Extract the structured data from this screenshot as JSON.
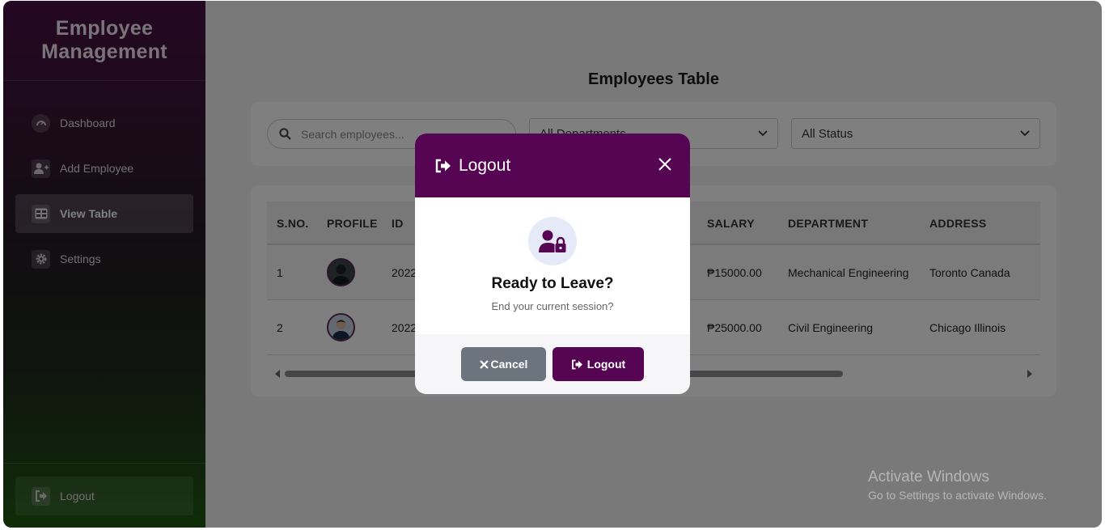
{
  "sidebar": {
    "brand": "Employee Management",
    "items": [
      {
        "label": "Dashboard",
        "icon": "dashboard-icon"
      },
      {
        "label": "Add Employee",
        "icon": "user-plus-icon"
      },
      {
        "label": "View Table",
        "icon": "table-icon",
        "active": true
      },
      {
        "label": "Settings",
        "icon": "gear-icon"
      }
    ],
    "logout_label": "Logout"
  },
  "main": {
    "title": "Employees Table",
    "search_placeholder": "Search employees...",
    "department_filter": "All Departments",
    "status_filter": "All Status",
    "table": {
      "columns": [
        "S.NO.",
        "PROFILE",
        "ID",
        "SALARY",
        "DEPARTMENT",
        "ADDRESS"
      ],
      "rows": [
        {
          "sno": "1",
          "id": "2022",
          "salary": "₱15000.00",
          "department": "Mechanical Engineering",
          "address": "Toronto Canada"
        },
        {
          "sno": "2",
          "id": "2022",
          "salary": "₱25000.00",
          "department": "Civil Engineering",
          "address": "Chicago Illinois"
        }
      ]
    }
  },
  "modal": {
    "title": "Logout",
    "heading": "Ready to Leave?",
    "message": "End your current session?",
    "cancel_label": "Cancel",
    "confirm_label": "Logout"
  },
  "watermark": {
    "line1": "Activate Windows",
    "line2": "Go to Settings to activate Windows."
  },
  "colors": {
    "accent": "#560552",
    "cancel": "#6c757d"
  }
}
